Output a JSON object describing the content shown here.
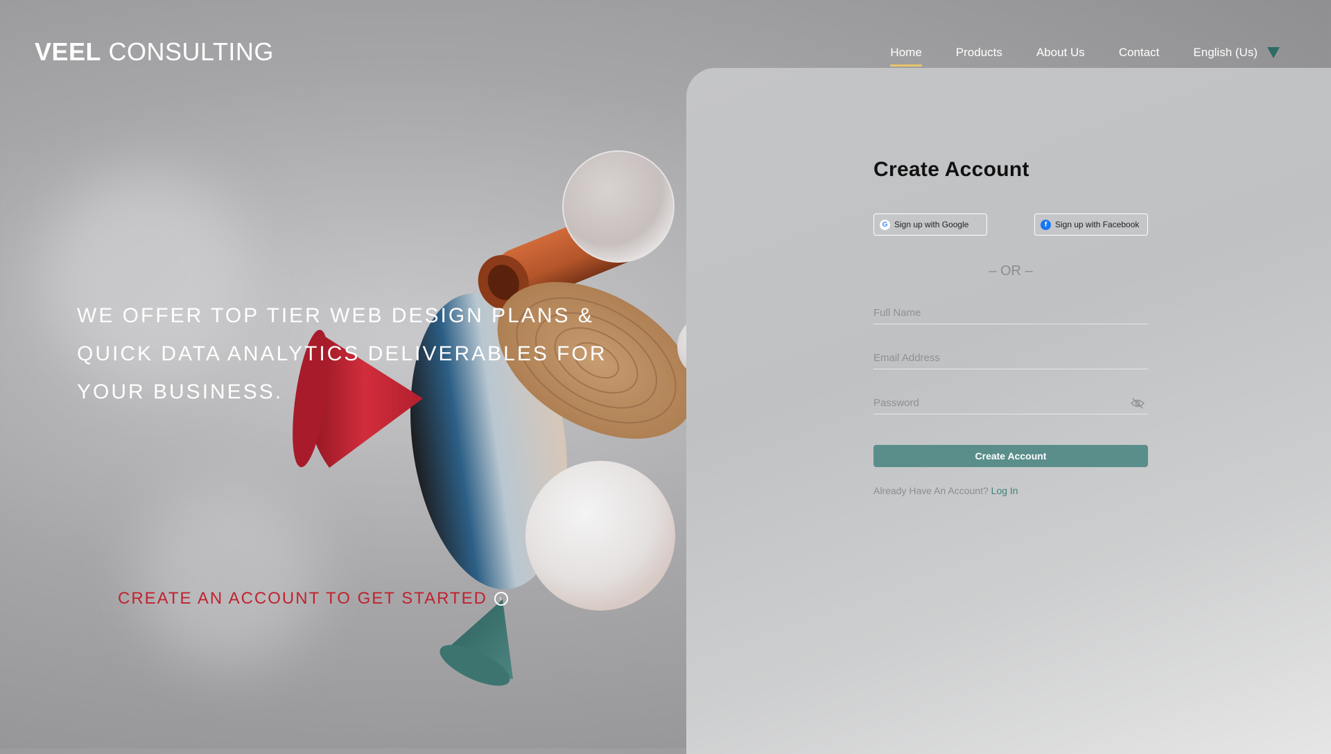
{
  "brand": {
    "bold": "VEEL",
    "light": "CONSULTING"
  },
  "nav": {
    "items": [
      {
        "label": "Home",
        "active": true
      },
      {
        "label": "Products",
        "active": false
      },
      {
        "label": "About Us",
        "active": false
      },
      {
        "label": "Contact",
        "active": false
      }
    ],
    "language": "English (Us)"
  },
  "hero": {
    "lines": [
      "We offer top tier web design plans &",
      "quick data analytics deliverables for",
      "your business."
    ],
    "cta": "Create an account to get started"
  },
  "form": {
    "title": "Create Account",
    "google_label": "Sign up with Google",
    "facebook_label": "Sign up with Facebook",
    "or_text": "– OR –",
    "full_name_placeholder": "Full Name",
    "email_placeholder": "Email Address",
    "password_placeholder": "Password",
    "submit_label": "Create Account",
    "login_prompt": "Already Have An Account?",
    "login_link": "Log In"
  },
  "colors": {
    "accent": "#5a8e8b",
    "cta": "#c0222e",
    "nav_underline": "#e9c46a",
    "dropdown_triangle": "#2f6b64"
  },
  "icons": [
    "google-icon",
    "facebook-icon",
    "eye-off-icon",
    "arrow-circle-icon",
    "chevron-down-icon"
  ]
}
